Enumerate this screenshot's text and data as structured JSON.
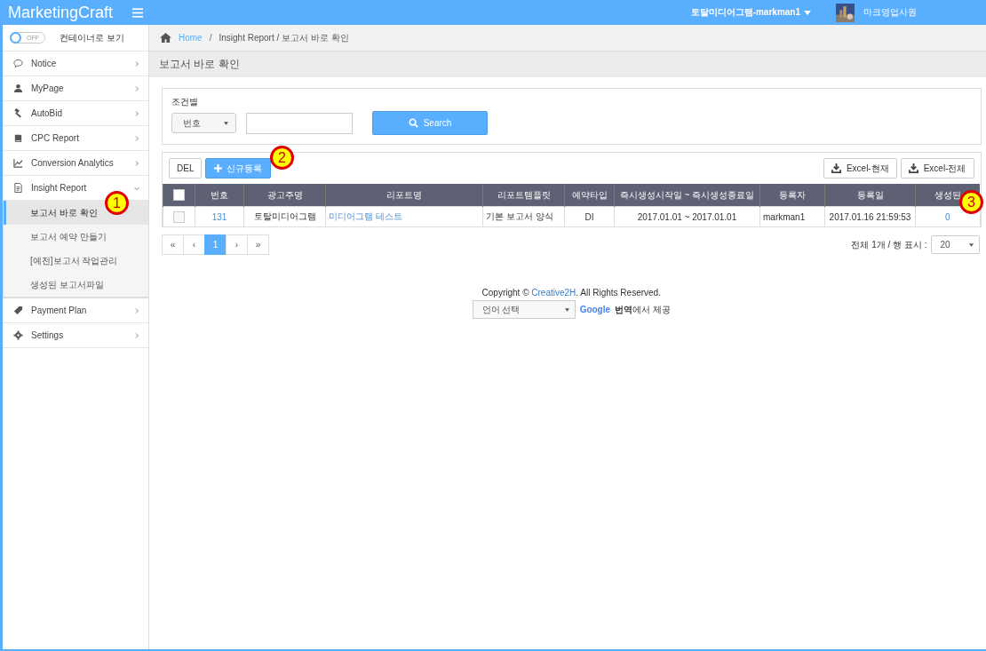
{
  "header": {
    "brand": "MarketingCraft",
    "account": "토탈미디어그램-markman1",
    "user": "마크영업사원"
  },
  "sidebar": {
    "toggle": {
      "label": "OFF",
      "on": false
    },
    "toggle_caption": "컨테이너로 보기",
    "items": [
      {
        "label": "Notice",
        "expanded": false
      },
      {
        "label": "MyPage",
        "expanded": false
      },
      {
        "label": "AutoBid",
        "expanded": false
      },
      {
        "label": "CPC Report",
        "expanded": false
      },
      {
        "label": "Conversion Analytics",
        "expanded": false
      },
      {
        "label": "Insight Report",
        "expanded": true,
        "children": [
          {
            "label": "보고서 바로 확인",
            "selected": true
          },
          {
            "label": "보고서 예약 만들기",
            "selected": false
          },
          {
            "label": "[예전]보고서 작업관리",
            "selected": false
          },
          {
            "label": "생성된 보고서파일",
            "selected": false
          }
        ]
      },
      {
        "label": "Payment Plan",
        "expanded": false
      },
      {
        "label": "Settings",
        "expanded": false
      }
    ]
  },
  "breadcrumb": {
    "home": "Home",
    "separator": "/",
    "path": "Insight Report / 보고서 바로 확인"
  },
  "page_title": "보고서 바로 확인",
  "filter": {
    "label": "조건별",
    "select": "번호",
    "search_button": "Search"
  },
  "toolbar": {
    "del": "DEL",
    "new": "신규등록",
    "excel_current": "Excel-현재",
    "excel_all": "Excel-전체"
  },
  "table": {
    "select_all": false,
    "columns": [
      "번호",
      "광고주명",
      "리포트명",
      "리포트템플릿",
      "예약타입",
      "즉시생성시작일 ~ 즉시생성종료일",
      "등록자",
      "등록일",
      "생성된"
    ],
    "rows": [
      {
        "checked": false,
        "cells": [
          {
            "text": "131",
            "link": true
          },
          {
            "text": "토탈미디어그램",
            "link": false
          },
          {
            "text": "미디어그램 테스트",
            "link": true
          },
          {
            "text": "기본 보고서 양식",
            "link": false
          },
          {
            "text": "DI",
            "link": false
          },
          {
            "text": "2017.01.01  ~ 2017.01.01",
            "link": false
          },
          {
            "text": "markman1",
            "link": false
          },
          {
            "text": "2017.01.16 21:59:53",
            "link": false
          },
          {
            "text": "0",
            "link": true
          }
        ]
      }
    ]
  },
  "pagination": [
    {
      "label": "«",
      "selected": false
    },
    {
      "label": "‹",
      "selected": false
    },
    {
      "label": "1",
      "selected": true
    },
    {
      "label": "›",
      "selected": false
    },
    {
      "label": "»",
      "selected": false
    }
  ],
  "summary": "전체 1개 / 행 표시 :",
  "page_size": "20",
  "footer": {
    "copyright_before": "Copyright © ",
    "copyright_link": "Creative2H",
    "copyright_after": ". All Rights Reserved.",
    "language_select": "언어 선택",
    "google": "Google",
    "powered": "**번역**에서 제공"
  },
  "annotations": [
    "1",
    "2",
    "3"
  ]
}
